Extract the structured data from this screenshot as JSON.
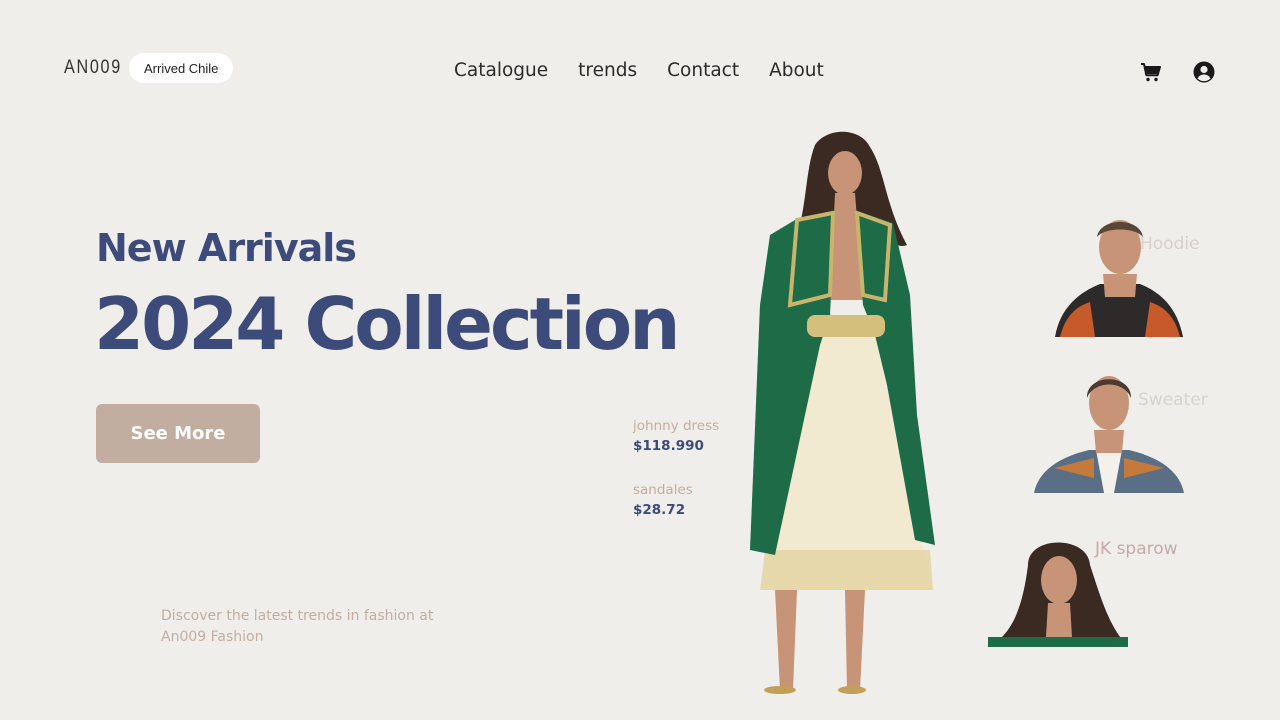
{
  "brand": {
    "logo": "AN009",
    "badge": "Arrived Chile"
  },
  "nav": [
    "Catalogue",
    "trends",
    "Contact",
    "About"
  ],
  "icons": {
    "cart": "cart-icon",
    "user": "user-icon"
  },
  "hero": {
    "subtitle": "New Arrivals",
    "title": "2024 Collection",
    "cta": "See More",
    "tagline": "Discover the latest trends in fashion at An009 Fashion"
  },
  "products": [
    {
      "name": "johnny dress",
      "price": "$118.990"
    },
    {
      "name": "sandales",
      "price": "$28.72"
    }
  ],
  "cards": [
    {
      "label": "Hoodie"
    },
    {
      "label": "Sweater"
    },
    {
      "label": "JK sparow"
    }
  ],
  "colors": {
    "accent": "#3d4b7a",
    "button": "#c2ada1",
    "muted": "#c4ada0",
    "background": "#f0eeeb"
  }
}
